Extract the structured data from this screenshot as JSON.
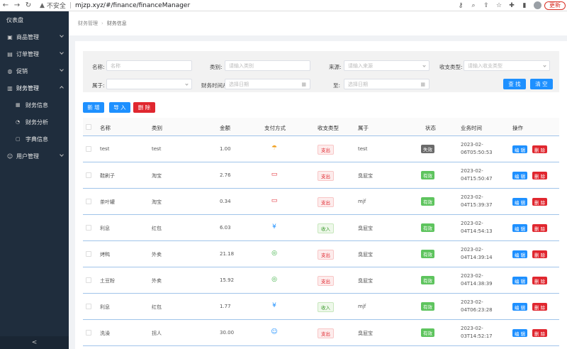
{
  "browser": {
    "security_text": "不安全",
    "url": "mjzp.xyz/#/finance/financeManager",
    "update_label": "更新"
  },
  "sidebar": {
    "items": [
      {
        "label": "仪表盘",
        "icon": "dashboard-icon"
      },
      {
        "label": "商品管理",
        "icon": "goods-icon"
      },
      {
        "label": "订单管理",
        "icon": "order-icon"
      },
      {
        "label": "促销",
        "icon": "promotion-icon"
      },
      {
        "label": "财务管理",
        "icon": "finance-icon"
      },
      {
        "label": "用户管理",
        "icon": "user-icon"
      }
    ],
    "submenu": [
      {
        "label": "财务信息",
        "icon": "finance-info-icon"
      },
      {
        "label": "财务分析",
        "icon": "finance-analysis-icon"
      },
      {
        "label": "字典信息",
        "icon": "dictionary-icon"
      }
    ],
    "collapse_glyph": "<"
  },
  "breadcrumb": {
    "parent": "财务管理",
    "separator": "›",
    "current": "财务信息"
  },
  "filters": {
    "name_label": "名称:",
    "name_placeholder": "名称",
    "category_label": "类别:",
    "category_placeholder": "请输入类别",
    "source_label": "来源:",
    "source_placeholder": "请输入来源",
    "type_label": "收支类型:",
    "type_placeholder": "请输入收支类型",
    "belong_label": "属于:",
    "time_label": "财务时间从",
    "start_placeholder": "选择日期",
    "to_label": "至:",
    "end_placeholder": "选择日期",
    "search_label": "查 找",
    "clear_label": "清 空"
  },
  "actions": {
    "add_label": "新 增",
    "import_label": "导 入",
    "delete_label": "删 除"
  },
  "table": {
    "headers": [
      "名称",
      "类别",
      "金额",
      "支付方式",
      "收支类型",
      "属于",
      "状态",
      "业务时间",
      "操作"
    ],
    "edit_label": "编 辑",
    "delete_label": "删 除",
    "rows": [
      {
        "name": "test",
        "category": "test",
        "amount": "1.00",
        "pay": "alipay-icon",
        "type": "支出",
        "type_kind": "out",
        "belong": "test",
        "status": "失效",
        "status_kind": "bad",
        "time1": "2023-02-",
        "time2": "06T05:50:53"
      },
      {
        "name": "鞋刷子",
        "category": "淘宝",
        "amount": "2.76",
        "pay": "card-icon",
        "type": "支出",
        "type_kind": "out",
        "belong": "臭屁宝",
        "status": "有效",
        "status_kind": "ok",
        "time1": "2023-02-",
        "time2": "04T15:50:47"
      },
      {
        "name": "茶叶罐",
        "category": "淘宝",
        "amount": "0.34",
        "pay": "card-icon",
        "type": "支出",
        "type_kind": "out",
        "belong": "mjf",
        "status": "有效",
        "status_kind": "ok",
        "time1": "2023-02-",
        "time2": "04T15:39:37"
      },
      {
        "name": "利息",
        "category": "红包",
        "amount": "6.03",
        "pay": "yen-icon",
        "type": "收入",
        "type_kind": "in",
        "belong": "臭屁宝",
        "status": "有效",
        "status_kind": "ok",
        "time1": "2023-02-",
        "time2": "04T14:54:13"
      },
      {
        "name": "烤鸭",
        "category": "外卖",
        "amount": "21.18",
        "pay": "wechat-icon",
        "type": "支出",
        "type_kind": "out",
        "belong": "臭屁宝",
        "status": "有效",
        "status_kind": "ok",
        "time1": "2023-02-",
        "time2": "04T14:39:14"
      },
      {
        "name": "土豆粉",
        "category": "外卖",
        "amount": "15.92",
        "pay": "wechat-icon",
        "type": "支出",
        "type_kind": "out",
        "belong": "臭屁宝",
        "status": "有效",
        "status_kind": "ok",
        "time1": "2023-02-",
        "time2": "04T14:38:39"
      },
      {
        "name": "利息",
        "category": "红包",
        "amount": "1.77",
        "pay": "yen-icon",
        "type": "收入",
        "type_kind": "in",
        "belong": "mjf",
        "status": "有效",
        "status_kind": "ok",
        "time1": "2023-02-",
        "time2": "04T06:23:28"
      },
      {
        "name": "洗澡",
        "category": "拐人",
        "amount": "30.00",
        "pay": "smile-icon",
        "type": "支出",
        "type_kind": "out",
        "belong": "臭屁宝",
        "status": "有效",
        "status_kind": "ok",
        "time1": "2023-02-",
        "time2": "03T14:52:17"
      }
    ]
  },
  "colors": {
    "sidebar_bg": "#1f2d3d",
    "primary": "#1e90ff",
    "danger": "#e0272f",
    "success": "#5ec45e"
  }
}
